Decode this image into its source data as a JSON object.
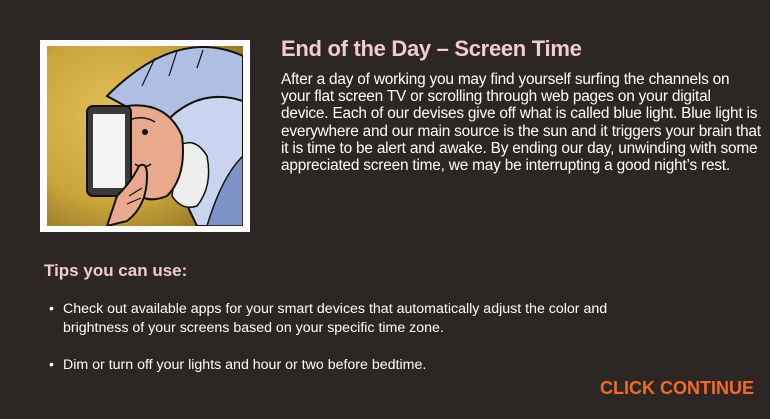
{
  "header": {
    "title": "End of the Day – Screen Time",
    "paragraph": "After a day of working you may find yourself surfing the channels on your flat screen TV or scrolling through web pages on your digital device.  Each of our devises give off what is called blue light. Blue light is everywhere and our main source is the sun and it triggers your brain that it is time to be alert and awake.  By ending our day, unwinding with some appreciated screen time, we may be interrupting a good night’s rest."
  },
  "tips": {
    "heading": "Tips you can use:",
    "items": [
      {
        "bullet": "•",
        "text": "Check out available apps for your smart devices that automatically adjust the color and brightness of your screens based on your specific time zone."
      },
      {
        "bullet": "•",
        "text": "Dim or turn off your lights and hour or two before bedtime."
      }
    ]
  },
  "cta": {
    "label": "CLICK CONTINUE"
  },
  "colors": {
    "background": "#2c2725",
    "title": "#f4c9d6",
    "cta": "#f26a24",
    "illustration_bg": "#c9a43a"
  }
}
